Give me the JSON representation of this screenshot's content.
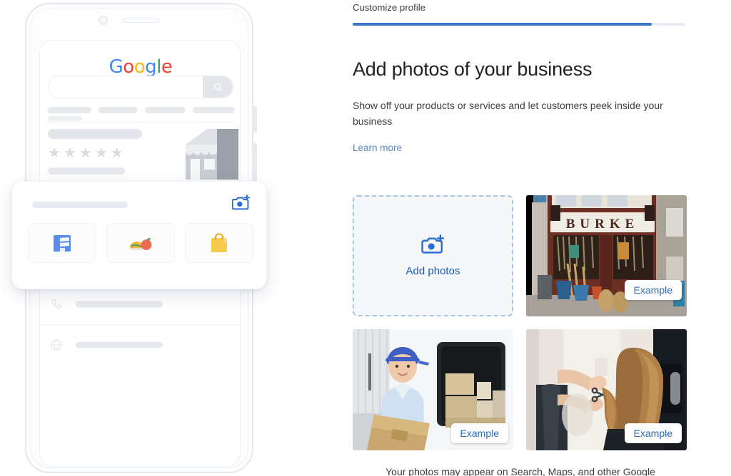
{
  "wizard": {
    "step_label": "Customize profile",
    "progress_percent": 90
  },
  "content": {
    "headline": "Add photos of your business",
    "subtext": "Show off your products or services and let customers peek inside your business",
    "learn_more_label": "Learn more",
    "footnote": "Your photos may appear on Search, Maps, and other Google"
  },
  "upload": {
    "add_photos_label": "Add photos",
    "add_icon": "camera-plus-icon"
  },
  "examples": [
    {
      "badge_label": "Example",
      "alt": "hardware store front with BURKE sign",
      "sign_text": "BURKE"
    },
    {
      "badge_label": "Example",
      "alt": "delivery person holding box beside van"
    },
    {
      "badge_label": "Example",
      "alt": "hairdresser styling long hair in salon"
    }
  ],
  "phone_preview": {
    "logo_letters": [
      "G",
      "o",
      "o",
      "g",
      "l",
      "e"
    ],
    "search_icon": "search-icon",
    "star_count": 5,
    "star_glyph": "★",
    "list_rows": [
      {
        "icon": "location-pin-icon"
      },
      {
        "icon": "clock-icon"
      },
      {
        "icon": "phone-icon"
      },
      {
        "icon": "globe-icon"
      }
    ]
  },
  "floating_card": {
    "camera_icon": "camera-plus-icon",
    "tiles": [
      {
        "icon": "storefront-icon",
        "color": "#4f7fe0"
      },
      {
        "icon": "food-icon",
        "color": "#eb6a52"
      },
      {
        "icon": "shopping-bag-icon",
        "color": "#f6c344"
      }
    ]
  },
  "colors": {
    "accent_blue": "#3b76c8",
    "link_blue": "#5b87b8",
    "dashed_border": "#a9c6e8",
    "text_primary": "#202124"
  }
}
